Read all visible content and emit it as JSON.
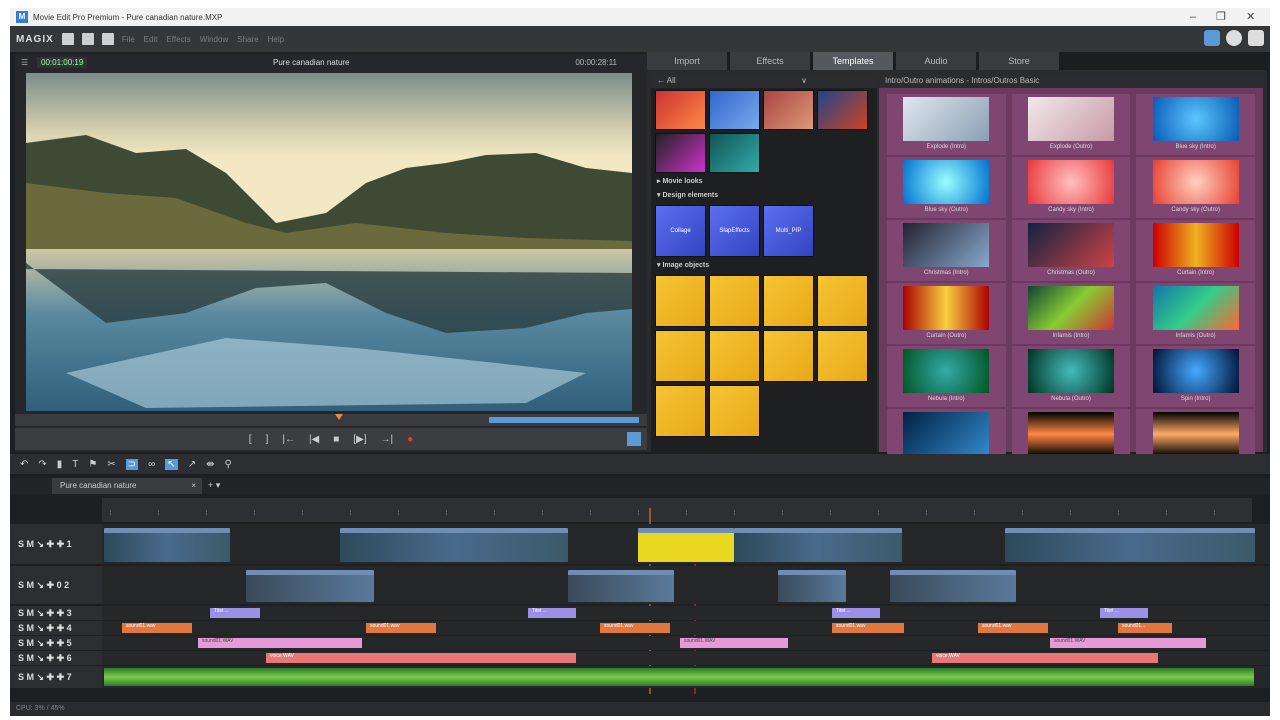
{
  "window": {
    "title": "Movie Edit Pro Premium - Pure canadian nature.MXP"
  },
  "menubar": {
    "logo": "MAGIX",
    "items": [
      "File",
      "Edit",
      "Effects",
      "Window",
      "Share",
      "Help"
    ]
  },
  "preview": {
    "timecode_left": "00:01:00:19",
    "title": "Pure canadian nature",
    "timecode_right": "00:00:28:11"
  },
  "pool": {
    "tabs": [
      "Import",
      "Effects",
      "Templates",
      "Audio",
      "Store"
    ],
    "active_tab": "Templates",
    "filter": "All",
    "sections": {
      "movie_looks": "Movie looks",
      "design_elements": "Design elements",
      "image_objects": "Image objects"
    },
    "design_items": [
      "Collage",
      "SlapEffects",
      "Multi_PIP"
    ],
    "grid_header": "Intro/Outro animations - Intros/Outros Basic",
    "grid_labels": [
      "Explode (Intro)",
      "Explode (Outro)",
      "Blue sky (Intro)",
      "Blue sky (Outro)",
      "Candy sky (Intro)",
      "Candy sky (Outro)",
      "Christmas (Intro)",
      "Christmas (Outro)",
      "Curtain (Intro)",
      "Curtain (Outro)",
      "Infamis (Intro)",
      "Infamis (Outro)",
      "Nebula (Intro)",
      "Nebula (Outro)",
      "Spin (Intro)",
      "",
      "",
      ""
    ]
  },
  "timeline": {
    "tab": "Pure canadian nature",
    "track_headers": [
      "S M ↘ ✚ ✚ 1",
      "S M ↘ ✚ 0 2",
      "S M ↘ ✚ ✚ 3",
      "S M ↘ ✚ ✚ 4",
      "S M ↘ ✚ ✚ 5",
      "S M ↘ ✚ ✚ 6",
      "S M ↘ ✚ ✚ 7"
    ],
    "audio_clips": [
      "sound01.wav",
      "sound01.wav",
      "sound01.wav",
      "sound01.wav",
      "sound01.wav",
      "sound01..."
    ],
    "title_clips": [
      "Titel ...",
      "Titel ...",
      "Titel ...",
      "Titel ..."
    ],
    "pink_clips": [
      "sound01.WAV",
      "sound01.WAV",
      "sound01.WAV"
    ],
    "red_clips": [
      "voice.WAV",
      "voice.WAV"
    ]
  },
  "status": {
    "text": "CPU: 3% / 45%"
  }
}
